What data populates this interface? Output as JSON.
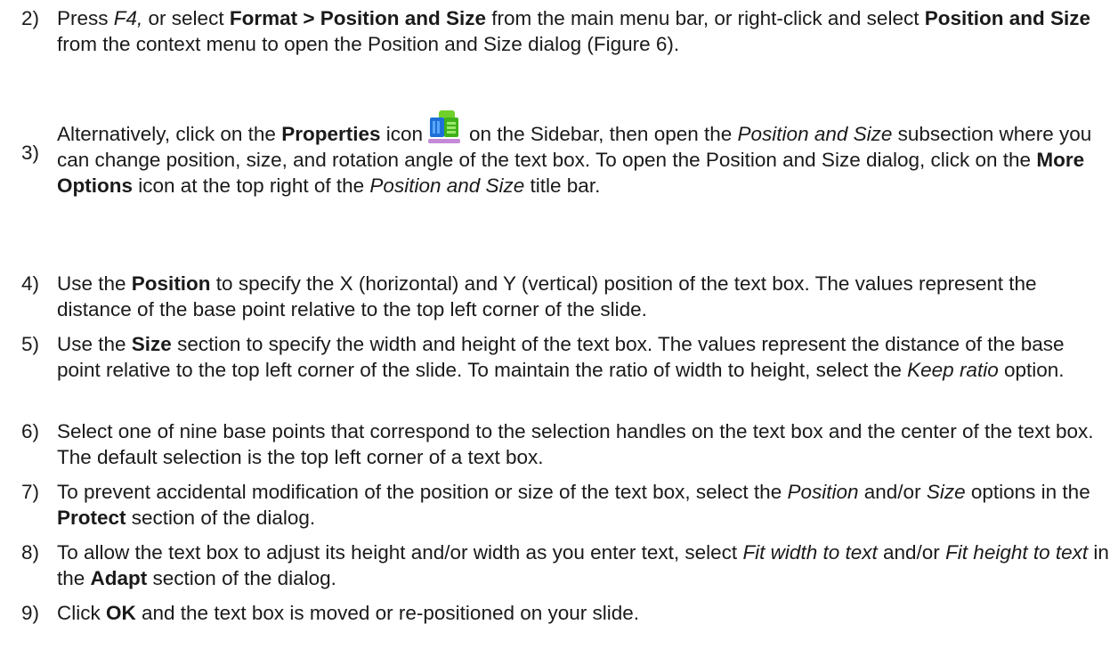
{
  "steps": [
    {
      "num": "2)",
      "segments": [
        {
          "t": "Press ",
          "s": "n"
        },
        {
          "t": "F4,",
          "s": "i"
        },
        {
          "t": " or select ",
          "s": "n"
        },
        {
          "t": "Format > Position and Size",
          "s": "b"
        },
        {
          "t": " from the main menu bar, or right-click and select ",
          "s": "n"
        },
        {
          "t": "Position and Size",
          "s": "b"
        },
        {
          "t": " from the context menu to open the Position and Size dialog (Figure 6).",
          "s": "n"
        }
      ]
    },
    {
      "num": "3)",
      "segments": [
        {
          "t": "Alternatively, click on the ",
          "s": "n"
        },
        {
          "t": "Properties",
          "s": "b"
        },
        {
          "t": " icon",
          "s": "n"
        },
        {
          "t": "",
          "s": "icon"
        },
        {
          "t": "on the Sidebar, then open the ",
          "s": "n"
        },
        {
          "t": "Position and Size",
          "s": "i"
        },
        {
          "t": " subsection where you can change position, size, and rotation angle of the text box. To open the Position and Size dialog, click on the ",
          "s": "n"
        },
        {
          "t": "More Options",
          "s": "b"
        },
        {
          "t": " icon at the top right of the ",
          "s": "n"
        },
        {
          "t": "Position and Size",
          "s": "i"
        },
        {
          "t": " title bar.",
          "s": "n"
        }
      ]
    },
    {
      "num": "4)",
      "segments": [
        {
          "t": "Use the ",
          "s": "n"
        },
        {
          "t": "Position",
          "s": "b"
        },
        {
          "t": " to specify the X (horizontal) and Y (vertical) position of the text box. The values represent the distance of the base point relative to the top left corner of the slide.",
          "s": "n"
        }
      ]
    },
    {
      "num": "5)",
      "segments": [
        {
          "t": "Use the ",
          "s": "n"
        },
        {
          "t": "Size",
          "s": "b"
        },
        {
          "t": " section to specify the width and height of the text box. The values represent the distance of the base point relative to the top left corner of the slide. To maintain the ratio of width to height, select the ",
          "s": "n"
        },
        {
          "t": "Keep ratio",
          "s": "i"
        },
        {
          "t": " option.",
          "s": "n"
        }
      ]
    },
    {
      "num": "6)",
      "segments": [
        {
          "t": "Select one of nine base points that correspond to the selection handles on the text box and the center of the text box. The default selection is the top left corner of a text box.",
          "s": "n"
        }
      ]
    },
    {
      "num": "7)",
      "segments": [
        {
          "t": "To prevent accidental modification of the position or size of the text box, select the ",
          "s": "n"
        },
        {
          "t": "Position",
          "s": "i"
        },
        {
          "t": " and/or ",
          "s": "n"
        },
        {
          "t": "Size",
          "s": "i"
        },
        {
          "t": " options in the ",
          "s": "n"
        },
        {
          "t": "Protect",
          "s": "b"
        },
        {
          "t": " section of the dialog.",
          "s": "n"
        }
      ]
    },
    {
      "num": "8)",
      "segments": [
        {
          "t": "To allow the text box to adjust its height and/or width as you enter text, select ",
          "s": "n"
        },
        {
          "t": "Fit width to text",
          "s": "i"
        },
        {
          "t": " and/or ",
          "s": "n"
        },
        {
          "t": "Fit height to text",
          "s": "i"
        },
        {
          "t": " in the ",
          "s": "n"
        },
        {
          "t": "Adapt",
          "s": "b"
        },
        {
          "t": " section of the dialog.",
          "s": "n"
        }
      ]
    },
    {
      "num": "9)",
      "segments": [
        {
          "t": "Click ",
          "s": "n"
        },
        {
          "t": "OK",
          "s": "b"
        },
        {
          "t": " and the text box is moved or re-positioned on your slide.",
          "s": "n"
        }
      ]
    }
  ],
  "icons": {
    "properties": "properties-icon"
  }
}
